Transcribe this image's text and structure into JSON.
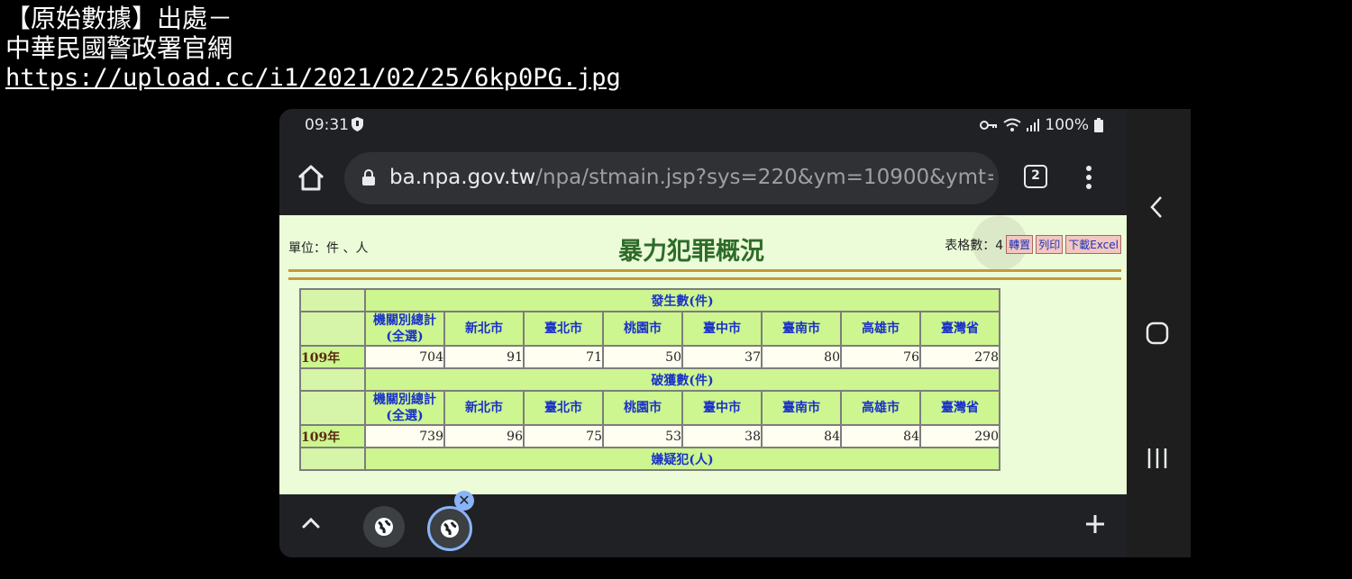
{
  "caption": {
    "line1": "【原始數據】出處－",
    "line2": "中華民國警政署官網",
    "link": "https://upload.cc/i1/2021/02/25/6kp0PG.jpg"
  },
  "status": {
    "time": "09:31",
    "battery": "100%",
    "icons": [
      "shield-icon",
      "key-icon",
      "wifi-icon",
      "signal-icon",
      "battery-icon"
    ]
  },
  "browser": {
    "url_host": "ba.npa.gov.tw",
    "url_path": "/npa/stmain.jsp?sys=220&ym=10900&ymt=",
    "tab_count": "2"
  },
  "page": {
    "unit": "單位：件 、人",
    "title": "暴力犯罪概況",
    "table_count_label": "表格數：4",
    "btn_transpose": "轉置",
    "btn_print": "列印",
    "btn_excel": "下載Excel"
  },
  "table": {
    "columns": [
      "機關別總計\n(全選)",
      "新北市",
      "臺北市",
      "桃園市",
      "臺中市",
      "臺南市",
      "高雄市",
      "臺灣省"
    ],
    "col_total_line1": "機關別總計",
    "col_total_line2": "(全選)",
    "sections": [
      {
        "header": "發生數(件)",
        "year": "109年",
        "values": [
          "704",
          "91",
          "71",
          "50",
          "37",
          "80",
          "76",
          "278"
        ]
      },
      {
        "header": "破獲數(件)",
        "year": "109年",
        "values": [
          "739",
          "96",
          "75",
          "53",
          "38",
          "84",
          "84",
          "290"
        ]
      },
      {
        "header": "嫌疑犯(人)"
      }
    ]
  },
  "colors": {
    "page_bg": "#ecfcd8",
    "cell_header": "#cdf590",
    "header_text": "#1a32c8",
    "title_green": "#2e6b2a",
    "accent_blue": "#8ab4f8"
  }
}
